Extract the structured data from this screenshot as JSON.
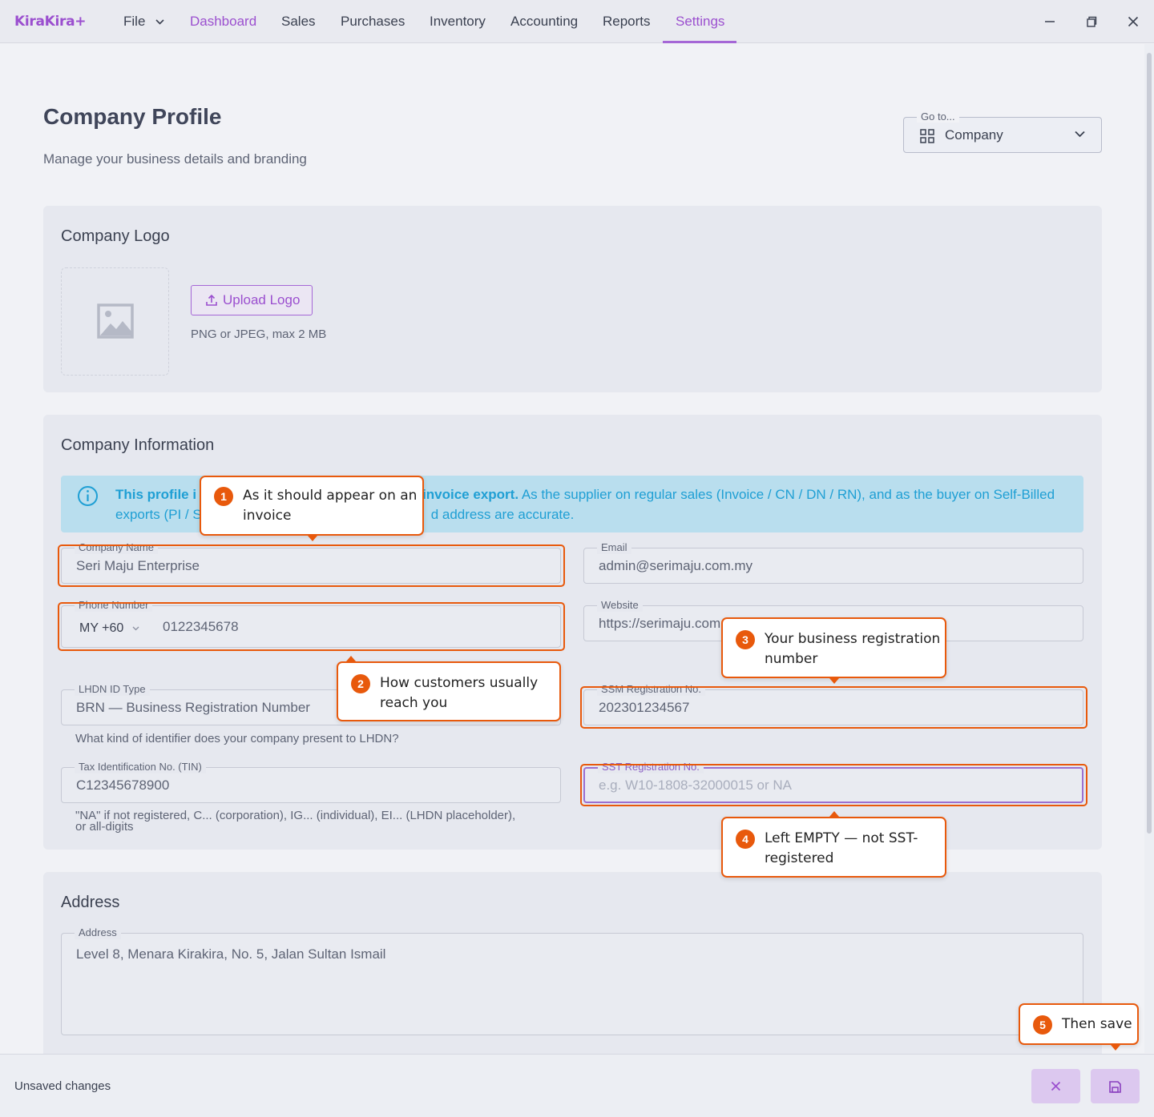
{
  "app": {
    "brand": "KiraKira+"
  },
  "menu": {
    "file": "File",
    "items": [
      "Dashboard",
      "Sales",
      "Purchases",
      "Inventory",
      "Accounting",
      "Reports",
      "Settings"
    ]
  },
  "page": {
    "title": "Company Profile",
    "subtitle": "Manage your business details and branding"
  },
  "goto": {
    "label": "Go to...",
    "value": "Company"
  },
  "logo_card": {
    "title": "Company Logo",
    "upload_label": "Upload Logo",
    "hint": "PNG or JPEG, max 2 MB"
  },
  "info_card": {
    "title": "Company Information",
    "banner": {
      "line1_bold_a": "This profile i",
      "line1_bold_b": "invoice export.",
      "line1_rest": " As the supplier on regular sales (Invoice / CN / DN / RN), and as the buyer on Self-Billed",
      "line2_a": "exports (PI / S",
      "line2_b": "d address are accurate."
    },
    "fields": {
      "company_name": {
        "label": "Company Name",
        "value": "Seri Maju Enterprise"
      },
      "email": {
        "label": "Email",
        "value": "admin@serimaju.com.my"
      },
      "phone": {
        "label": "Phone Number",
        "country": "MY +60",
        "value": "0122345678"
      },
      "website": {
        "label": "Website",
        "value": "https://serimaju.com"
      },
      "lhdn_id_type": {
        "label": "LHDN ID Type",
        "value": "BRN — Business Registration Number",
        "helper": "What kind of identifier does your company present to LHDN?"
      },
      "ssm": {
        "label": "SSM Registration No.",
        "value": "202301234567"
      },
      "tin": {
        "label": "Tax Identification No. (TIN)",
        "value": "C12345678900",
        "helper_1": "\"NA\" if not registered, C... (corporation), IG... (individual), EI... (LHDN placeholder),",
        "helper_2": "or all-digits"
      },
      "sst": {
        "label": "SST Registration No.",
        "placeholder": "e.g. W10-1808-32000015 or NA"
      }
    }
  },
  "address_card": {
    "title": "Address",
    "field": {
      "label": "Address",
      "value": "Level 8, Menara Kirakira, No. 5, Jalan Sultan Ismail"
    }
  },
  "callouts": [
    {
      "num": "1",
      "line1": "As it should appear on an",
      "line2": "invoice"
    },
    {
      "num": "2",
      "line1": "How customers usually",
      "line2": "reach you"
    },
    {
      "num": "3",
      "line1": "Your business registration",
      "line2": "number"
    },
    {
      "num": "4",
      "line1": "Left EMPTY — not SST-",
      "line2": "registered"
    },
    {
      "num": "5",
      "line1": "Then save",
      "line2": ""
    }
  ],
  "footer": {
    "status": "Unsaved changes"
  },
  "colors": {
    "accent": "#9b4fcf",
    "highlight": "#e8590c",
    "info": "#1f9fd4",
    "info_bg": "#b9deee"
  },
  "icons": [
    "chevron-down-icon",
    "minimize-icon",
    "restore-icon",
    "close-icon",
    "grid-icon",
    "image-icon",
    "upload-icon",
    "info-icon",
    "x-icon",
    "save-icon"
  ]
}
